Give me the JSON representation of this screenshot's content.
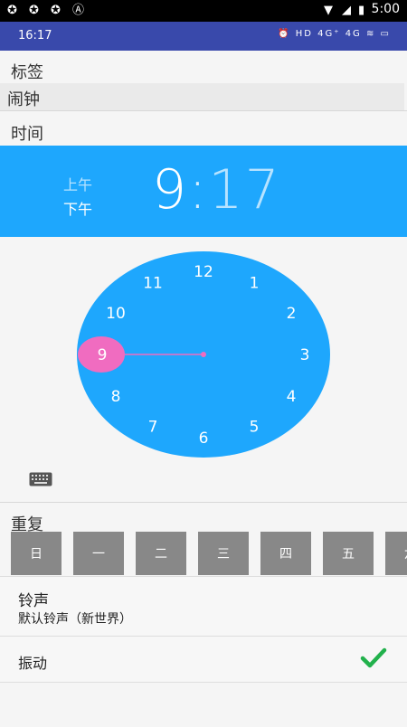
{
  "system_bar": {
    "time": "5:00",
    "left_icons": [
      "sync-icon",
      "sync-icon",
      "sync-icon",
      "a-icon"
    ],
    "right_icons": [
      "wifi-icon",
      "signal-icon",
      "battery-icon"
    ]
  },
  "app_status": {
    "time": "16:17",
    "icons": "⏰ HD 4G⁺ 4G ≋ ▭"
  },
  "label_section": {
    "title": "标签",
    "value": "闹钟"
  },
  "time_section": {
    "title": "时间"
  },
  "time_header": {
    "am": "上午",
    "pm": "下午",
    "hour": "9",
    "colon": ":",
    "minute": "17",
    "selected_period": "pm",
    "accent": "#1ea7fd"
  },
  "clock": {
    "numbers": [
      "12",
      "1",
      "2",
      "3",
      "4",
      "5",
      "6",
      "7",
      "8",
      "9",
      "10",
      "11"
    ],
    "selected_hour": "9",
    "face_color": "#1ea7fd",
    "hand_color": "#f06cc0"
  },
  "repeat": {
    "title": "重复",
    "days": [
      "日",
      "一",
      "二",
      "三",
      "四",
      "五",
      "六"
    ]
  },
  "ringtone": {
    "title": "铃声",
    "value": "默认铃声（新世界）"
  },
  "vibrate": {
    "label": "振动",
    "checked": true,
    "check_color": "#22b14c"
  }
}
